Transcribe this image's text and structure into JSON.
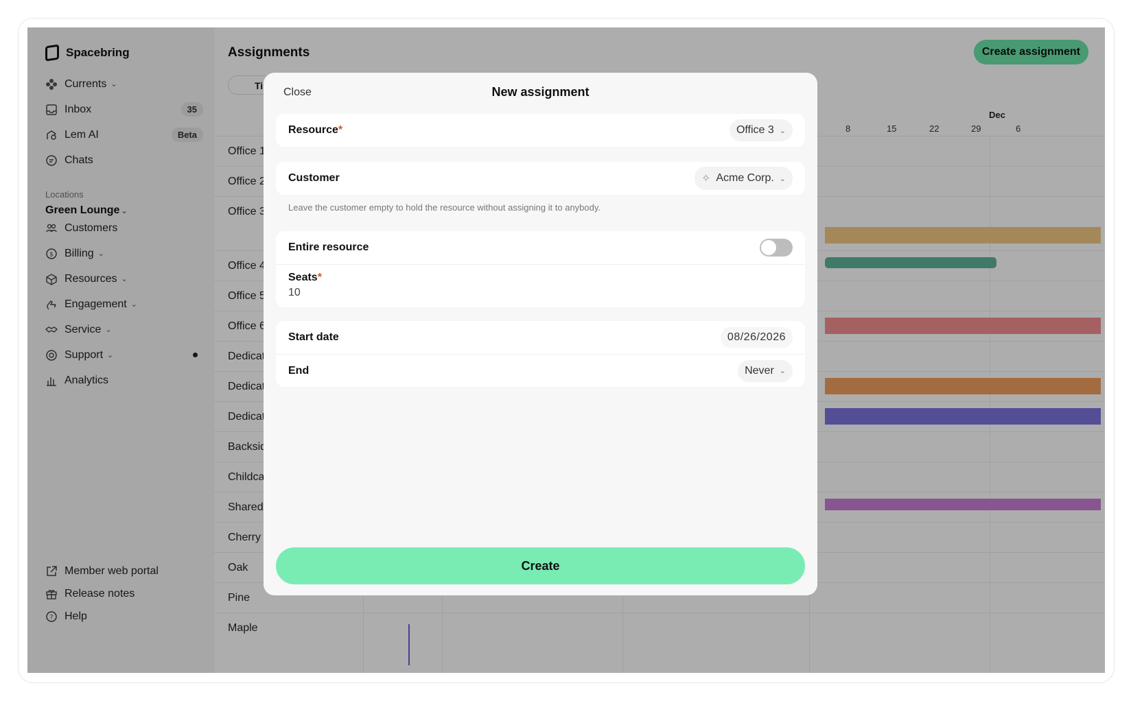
{
  "sidebar": {
    "brand": "Spacebring",
    "items_top": [
      {
        "label": "Currents",
        "icon": "currents-icon",
        "chevron": true
      },
      {
        "label": "Inbox",
        "icon": "inbox-icon",
        "badge": "35"
      },
      {
        "label": "Lem AI",
        "icon": "lem-ai-icon",
        "badge": "Beta"
      },
      {
        "label": "Chats",
        "icon": "chats-icon"
      }
    ],
    "locations_label": "Locations",
    "location_name": "Green Lounge",
    "items_location": [
      {
        "label": "Customers",
        "icon": "customers-icon"
      },
      {
        "label": "Billing",
        "icon": "billing-icon",
        "chevron": true
      },
      {
        "label": "Resources",
        "icon": "resources-icon",
        "chevron": true
      },
      {
        "label": "Engagement",
        "icon": "engagement-icon",
        "chevron": true
      },
      {
        "label": "Service",
        "icon": "service-icon",
        "chevron": true
      },
      {
        "label": "Support",
        "icon": "support-icon",
        "chevron": true,
        "dot": true
      },
      {
        "label": "Analytics",
        "icon": "analytics-icon"
      }
    ],
    "items_bottom": [
      {
        "label": "Member web portal",
        "icon": "external-link-icon"
      },
      {
        "label": "Release notes",
        "icon": "gift-icon"
      },
      {
        "label": "Help",
        "icon": "help-icon"
      }
    ]
  },
  "main": {
    "title": "Assignments",
    "create_button": "Create assignment",
    "view_toggle": "Time",
    "month_label": "Dec",
    "dates": [
      "8",
      "15",
      "22",
      "29",
      "6"
    ],
    "rows": [
      "Office 1",
      "Office 2",
      "Office 3",
      "Office 4",
      "Office 5",
      "Office 6",
      "Dedicated",
      "Dedicated",
      "Dedicated",
      "Backside",
      "Childcare",
      "Shared W",
      "Cherry",
      "Oak",
      "Pine",
      "Maple"
    ],
    "bar_colors": [
      "#f3c985",
      "#5fb39a",
      "#f48f8f",
      "#f0a05f",
      "#7b73dd",
      "#c77fd6"
    ]
  },
  "modal": {
    "close": "Close",
    "title": "New assignment",
    "resource_label": "Resource",
    "resource_value": "Office 3",
    "customer_label": "Customer",
    "customer_value": "Acme Corp.",
    "customer_hint": "Leave the customer empty to hold the resource without assigning it to anybody.",
    "entire_resource_label": "Entire resource",
    "entire_resource_on": false,
    "seats_label": "Seats",
    "seats_value": "10",
    "start_date_label": "Start date",
    "start_date_value": "08/26/2026",
    "end_label": "End",
    "end_value": "Never",
    "create_button": "Create"
  }
}
